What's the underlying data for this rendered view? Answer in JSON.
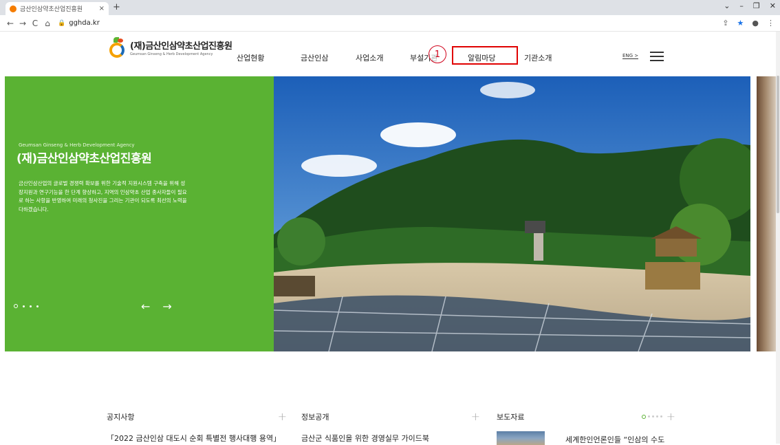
{
  "browser": {
    "tab_title": "금산인삼약초산업진흥원",
    "tab_close": "×",
    "new_tab": "+",
    "url": "gghda.kr",
    "nav_back": "←",
    "nav_forward": "→",
    "nav_reload": "C",
    "nav_home": "⌂",
    "window_controls": [
      "⌄",
      "–",
      "❐",
      "✕"
    ]
  },
  "header": {
    "logo_main": "(재)금산인삼약초산업진흥원",
    "logo_sub": "Geumsan Ginseng & Herb Development Agency",
    "menu": [
      "산업현황",
      "금산인삼",
      "사업소개",
      "부설기관",
      "알림마당",
      "기관소개"
    ],
    "highlighted_menu": "알림마당",
    "annotation_number": "1",
    "lang": "ENG >",
    "accent_color": "#5ab233",
    "highlight_color": "#e00000"
  },
  "hero": {
    "small_title": "Geumsan Ginseng & Herb Development Agency",
    "title": "(재)금산인삼약초산업진흥원",
    "description": "금산인삼산업의 글로벌 경쟁력 확보를 위한 기술적 지원시스템 구축을 위해 성장지원과 연구기능을 한 단계 향상하고, 지역의 인삼약초 산업 종사자들이 필요로 하는 사항을 반영하여 미래의 청사진을 그리는 기관이 되도록 최선의 노력을 다하겠습니다.",
    "prev_arrow": "←",
    "next_arrow": "→"
  },
  "news": {
    "notice": {
      "title": "공지사항",
      "first_item": "「2022 금산인삼 대도시 순회 특별전 행사대행 용역」"
    },
    "info": {
      "title": "정보공개",
      "first_item": "금산군 식품인을 위한 경영실무 가이드북"
    },
    "press": {
      "title": "보도자료",
      "first_item": "세계한인언론인들 “인삼의 수도"
    },
    "plus": "+"
  }
}
